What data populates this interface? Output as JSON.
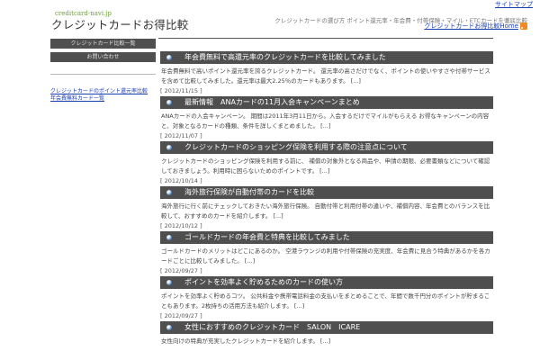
{
  "header": {
    "top_link": "サイトマップ",
    "logo_small": "creditcard-navi.jp",
    "logo_main": "クレジットカードお得比較",
    "description": "クレジットカードの選び方 ポイント還元率・年会費・付帯保険・マイル・ETCカードを徹底比較",
    "nav_link": "クレジットカードお得比較Home"
  },
  "sidebar": {
    "buttons": [
      "クレジットカード比較一覧",
      "お問い合わせ"
    ],
    "links": [
      "クレジットカードのポイント還元率比較",
      "年会費無料カード一覧"
    ]
  },
  "posts": [
    {
      "title": "年会費無料で高還元率のクレジットカードを比較してみました",
      "excerpt": "年会費無料で高いポイント還元率を誇るクレジットカード。 還元率の高さだけでなく、ポイントの使いやすさや付帯サービスを含めて比較してみました。還元率は最大2.25％のカードもあります。 [...]",
      "date": "[ 2012/11/15 ]"
    },
    {
      "title": "最新情報　ANAカードの11月入会キャンペーンまとめ",
      "excerpt": "ANAカードの入会キャンペーン。 期間は2011年3月11日から。入会するだけでマイルがもらえる お得なキャンペーンの内容と、対象となるカードの種類、条件を詳しくまとめました。 [...]",
      "date": "[ 2012/11/07 ]"
    },
    {
      "title": "クレジットカードのショッピング保険を利用する際の注意点について",
      "excerpt": "クレジットカードのショッピング保険を利用する前に、 補償の対象外となる商品や、申請の期限、必要書類などについて確認しておきましょう。利用時に困らないためのポイントです。 [...]",
      "date": "[ 2012/10/14 ]"
    },
    {
      "title": "海外旅行保険が自動付帯のカードを比較",
      "excerpt": "海外旅行に行く前にチェックしておきたい海外旅行保険。 自動付帯と利用付帯の違いや、補償内容、年会費とのバランスを比較して、おすすめのカードを紹介します。 [...]",
      "date": "[ 2012/10/12 ]"
    },
    {
      "title": "ゴールドカードの年会費と特典を比較してみました",
      "excerpt": "ゴールドカードのメリットはどこにあるのか。 空港ラウンジの利用や付帯保険の充実度、年会費に見合う特典があるかを各カードごとに比較してみました。 [...]",
      "date": "[ 2012/09/27 ]"
    },
    {
      "title": "ポイントを効率よく貯めるためのカードの使い方",
      "excerpt": "ポイントを効率よく貯めるコツ。 公共料金や携帯電話料金の支払いをまとめることで、年間で数千円分のポイントが貯まることもあります。2枚持ちの活用方法も紹介します。 [...]",
      "date": "[ 2012/09/27 ]"
    },
    {
      "title": "女性におすすめのクレジットカード　SALON　ICARE",
      "excerpt": "女性向けの特典が充実したクレジットカードを紹介します。 [...]",
      "date": ""
    }
  ]
}
